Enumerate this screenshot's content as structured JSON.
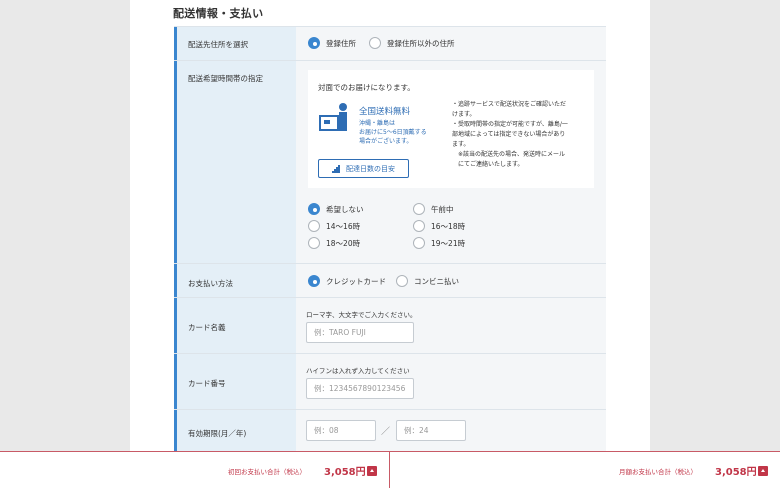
{
  "section_title": "配送情報・支払い",
  "address": {
    "label": "配送先住所を選択",
    "options": [
      "登録住所",
      "登録住所以外の住所"
    ],
    "selected": 0
  },
  "delivery_time": {
    "label": "配送希望時間帯の指定",
    "notice": "対面でのお届けになります。",
    "free_shipping": "全国送料無料",
    "okinawa_line1": "沖縄・離島は",
    "okinawa_line2": "お届けに5〜6日頂戴する",
    "okinawa_line3": "場合がございます。",
    "note_lines": [
      "・追跡サービスで配送状況をご確認いただ",
      "けます。",
      "・受取時間帯の指定が可能ですが、離島/一",
      "部地域によっては指定できない場合があり",
      "ます。",
      "　※該当の配送先の場合、発送時にメール",
      "　にてご連絡いたします。"
    ],
    "days_button": "配達日数の目安",
    "options": [
      "希望しない",
      "午前中",
      "14〜16時",
      "16〜18時",
      "18〜20時",
      "19〜21時"
    ],
    "selected": 0
  },
  "payment": {
    "label": "お支払い方法",
    "options": [
      "クレジットカード",
      "コンビニ払い"
    ],
    "selected": 0
  },
  "card_name": {
    "label": "カード名義",
    "hint": "ローマ字、大文字でご入力ください。",
    "placeholder": "例：TARO FUJI"
  },
  "card_number": {
    "label": "カード番号",
    "hint": "ハイフンは入れず入力してください",
    "placeholder": "例：1234567890123456"
  },
  "expiry": {
    "label": "有効期限(月／年)",
    "month_placeholder": "例：08",
    "separator": "／",
    "year_placeholder": "例：24"
  },
  "footer": {
    "first_label": "初回お支払い合計（税込）",
    "first_price": "3,058円",
    "monthly_label": "月額お支払い合計（税込）",
    "monthly_price": "3,058円"
  },
  "colors": {
    "accent": "#3a86cf",
    "label_bg": "#e4eff7",
    "price": "#c13648"
  }
}
